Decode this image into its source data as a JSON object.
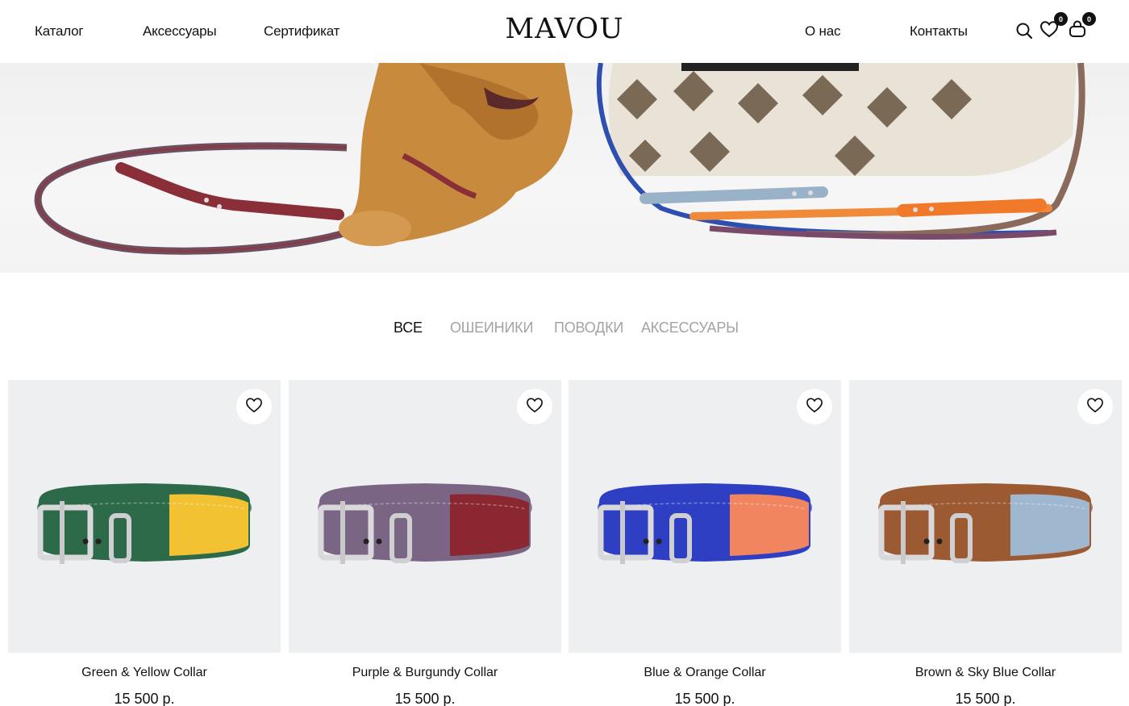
{
  "header": {
    "nav_left": [
      "Каталог",
      "Аксессуары",
      "Сертификат"
    ],
    "logo": "MAVOU",
    "nav_right": [
      "О нас",
      "Контакты"
    ],
    "icons": [
      "search-icon",
      "heart-icon",
      "bag-icon"
    ],
    "wishlist_count": "0",
    "cart_count": "0"
  },
  "tabs": {
    "items": [
      "ВСЕ",
      "ОШЕИНИКИ",
      "ПОВОДКИ",
      "АКСЕССУАРЫ"
    ],
    "active": "ВСЕ"
  },
  "products": [
    {
      "name": "Green & Yellow Collar",
      "price": "15 500 р.",
      "colors": [
        "#2d6a4a",
        "#f2c232"
      ]
    },
    {
      "name": "Purple & Burgundy Collar",
      "price": "15 500 р.",
      "colors": [
        "#7a6684",
        "#8a2730"
      ]
    },
    {
      "name": "Blue & Orange Collar",
      "price": "15 500 р.",
      "colors": [
        "#2f3fc4",
        "#f0855f"
      ]
    },
    {
      "name": "Brown & Sky Blue Collar",
      "price": "15 500 р.",
      "colors": [
        "#9c5a32",
        "#9fb8cf"
      ]
    }
  ],
  "colors": {
    "text": "#111111",
    "tab_inactive": "#a3a3a3",
    "card_bg": "#eeeff1"
  }
}
